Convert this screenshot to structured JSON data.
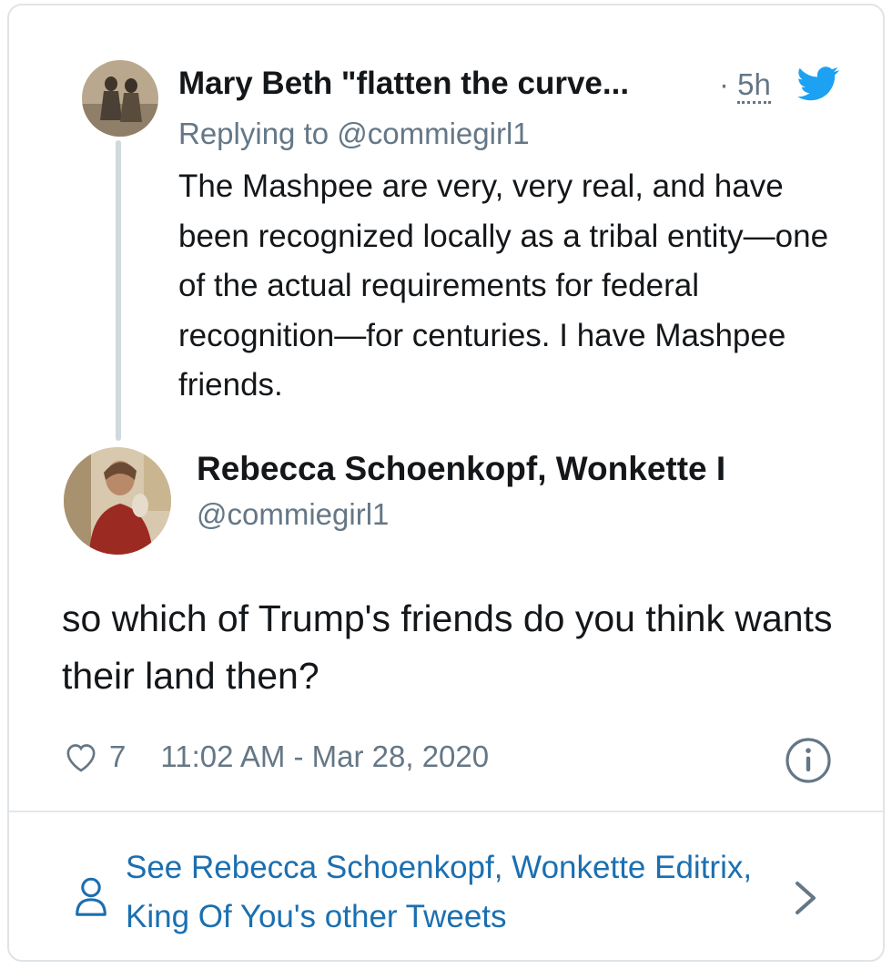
{
  "colors": {
    "text": "#14171a",
    "muted": "#657786",
    "link": "#1b6fb0",
    "twitter_blue": "#1da1f2",
    "border": "#dfe4e8"
  },
  "parent_tweet": {
    "author_name": "Mary Beth \"flatten the curve...",
    "time_sep": "·",
    "time": "5h",
    "replying_to": "Replying to @commiegirl1",
    "text": "The Mashpee are very, very real, and have been recognized locally as a tribal entity—one of the actual requirements for federal recognition—for centuries. I have Mashpee friends.",
    "icon": "twitter-bird-icon"
  },
  "main_tweet": {
    "author_name": "Rebecca Schoenkopf, Wonkette I",
    "handle": "@commiegirl1",
    "text": "so which of Trump's friends do you think wants their land then?",
    "likes": "7",
    "timestamp": "11:02 AM - Mar 28, 2020",
    "icons": [
      "heart-icon",
      "info-icon"
    ]
  },
  "footer": {
    "link_text": "See Rebecca Schoenkopf, Wonkette Editrix, King Of You's other Tweets",
    "icons": [
      "person-icon",
      "chevron-right-icon"
    ]
  }
}
